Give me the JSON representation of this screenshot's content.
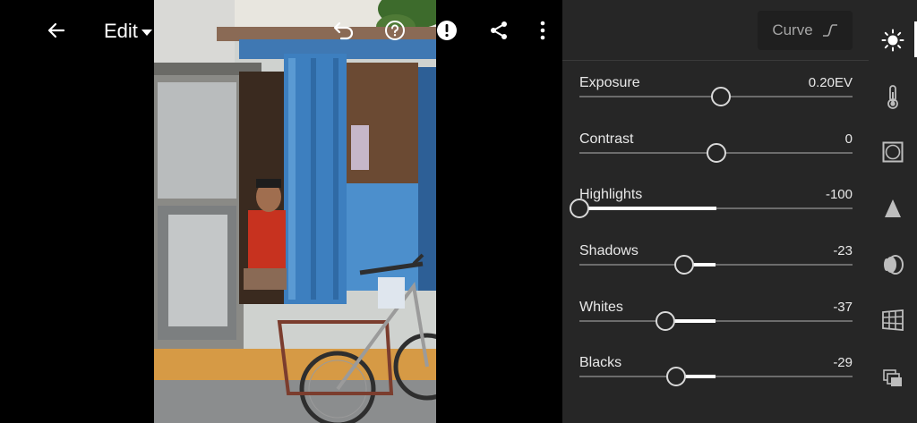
{
  "toolbar": {
    "back_icon": "arrow-left-icon",
    "edit_label": "Edit",
    "undo_icon": "undo-icon",
    "help_icon": "help-icon",
    "alert_icon": "alert-icon",
    "share_icon": "share-icon",
    "more_icon": "more-vertical-icon"
  },
  "panel": {
    "curve_label": "Curve",
    "sliders": [
      {
        "label": "Exposure",
        "value": "0.20EV",
        "level": 0.518
      },
      {
        "label": "Contrast",
        "value": "0",
        "level": 0.5
      },
      {
        "label": "Highlights",
        "value": "-100",
        "level": 0.0
      },
      {
        "label": "Shadows",
        "value": "-23",
        "level": 0.385
      },
      {
        "label": "Whites",
        "value": "-37",
        "level": 0.315
      },
      {
        "label": "Blacks",
        "value": "-29",
        "level": 0.355
      }
    ]
  },
  "rail": {
    "items": [
      "light-icon",
      "color-temperature-icon",
      "effects-vignette-icon",
      "detail-icon",
      "optics-icon",
      "geometry-icon",
      "versions-icon"
    ],
    "active": "light-icon"
  },
  "colors": {
    "panel_bg": "#262626",
    "track": "#6c6c6c",
    "fill": "#ffffff"
  }
}
